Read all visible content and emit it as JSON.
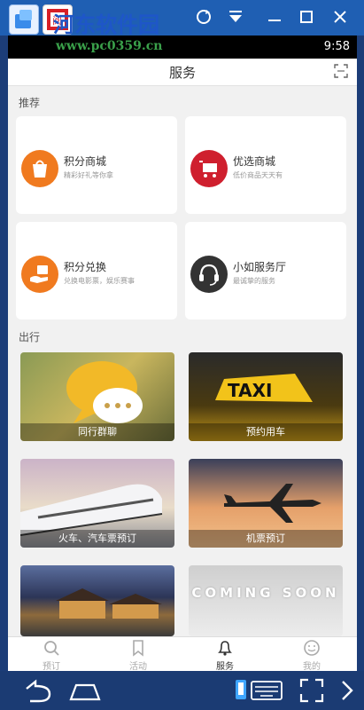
{
  "emulator": {
    "watermark_title": "河东软件园",
    "watermark_url": "www.pc0359.cn"
  },
  "status": {
    "time": "9:58"
  },
  "header": {
    "title": "服务"
  },
  "sections": {
    "recommend": {
      "title": "推荐",
      "cards": [
        {
          "title": "积分商城",
          "subtitle": "精彩好礼等你拿",
          "color": "#f07a1f"
        },
        {
          "title": "优选商城",
          "subtitle": "低价商品天天有",
          "color": "#cf1f2e"
        },
        {
          "title": "积分兑换",
          "subtitle": "兑换电影票，娱乐赛事",
          "color": "#f07a1f"
        },
        {
          "title": "小如服务厅",
          "subtitle": "最诚挚的服务",
          "color": "#333333"
        }
      ]
    },
    "travel": {
      "title": "出行",
      "tiles": [
        {
          "caption": "同行群聊"
        },
        {
          "caption": "预约用车"
        },
        {
          "caption": "火车、汽车票预订"
        },
        {
          "caption": "机票预订"
        },
        {
          "caption": ""
        },
        {
          "caption": "",
          "overlay": "COMING SOON"
        }
      ]
    }
  },
  "tabs": [
    {
      "label": "预订",
      "icon": "search-icon"
    },
    {
      "label": "活动",
      "icon": "bookmark-icon"
    },
    {
      "label": "服务",
      "icon": "bell-icon",
      "active": true
    },
    {
      "label": "我的",
      "icon": "smile-icon"
    }
  ]
}
